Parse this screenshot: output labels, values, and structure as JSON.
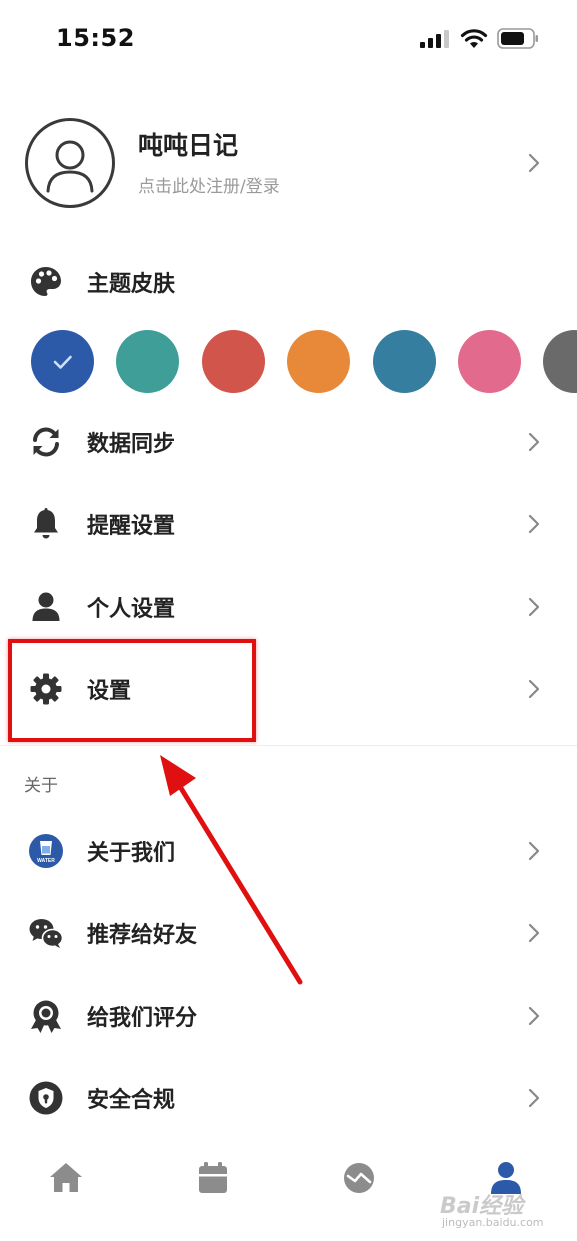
{
  "status": {
    "time": "15:52"
  },
  "profile": {
    "name": "吨吨日记",
    "subtitle": "点击此处注册/登录"
  },
  "theme": {
    "label": "主题皮肤",
    "swatches": [
      "#2d5aa8",
      "#3f9e98",
      "#d2554c",
      "#e8893a",
      "#357e9f",
      "#e26b8d",
      "#6a6a6a"
    ]
  },
  "menu": {
    "sync": "数据同步",
    "reminder": "提醒设置",
    "personal": "个人设置",
    "settings": "设置"
  },
  "about": {
    "section_title": "关于",
    "about_us": "关于我们",
    "recommend": "推荐给好友",
    "rate": "给我们评分",
    "compliance": "安全合规",
    "water_badge": "WATER"
  },
  "watermark": {
    "brand": "Bai经验",
    "url": "jingyan.baidu.com"
  },
  "colors": {
    "accent": "#2d5aa8",
    "highlight": "#e01010",
    "icon": "#333333"
  }
}
